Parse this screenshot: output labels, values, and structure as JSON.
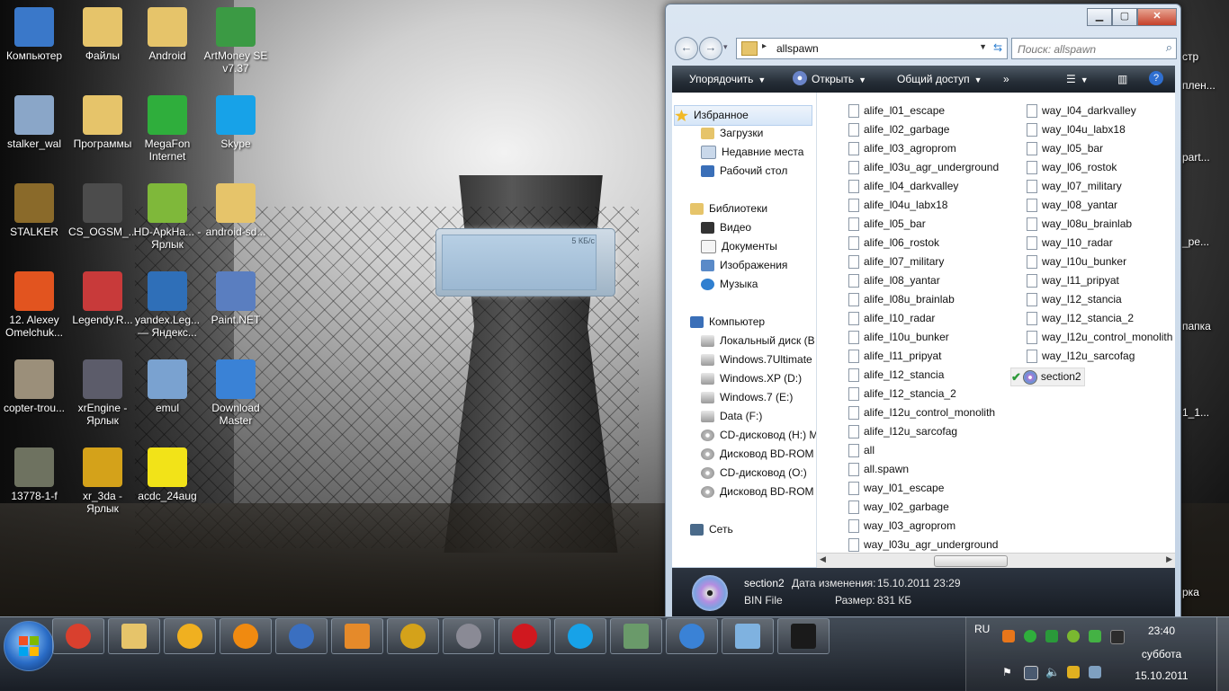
{
  "desktop": {
    "icons": [
      {
        "label": "Компьютер",
        "icon": "computer-icon",
        "color": "#3a78c9"
      },
      {
        "label": "Файлы",
        "icon": "folder-icon",
        "color": "#e6c46a"
      },
      {
        "label": "Android",
        "icon": "folder-icon",
        "color": "#e6c46a"
      },
      {
        "label": "ArtMoney SE v7.37",
        "icon": "money-icon",
        "color": "#3b9a44"
      },
      {
        "label": "stalker_wal",
        "icon": "image-icon",
        "color": "#8aa6c8"
      },
      {
        "label": "Программы",
        "icon": "folder-icon",
        "color": "#e6c46a"
      },
      {
        "label": "MegaFon Internet",
        "icon": "megafon-icon",
        "color": "#2fae3c"
      },
      {
        "label": "Skype",
        "icon": "skype-icon",
        "color": "#17a2e8"
      },
      {
        "label": "STALKER",
        "icon": "game-icon",
        "color": "#8a6a2a"
      },
      {
        "label": "CS_OGSM_...",
        "icon": "radiation-icon",
        "color": "#4c4c4c"
      },
      {
        "label": "HD-ApkHa... - Ярлык",
        "icon": "android-icon",
        "color": "#7fb83a"
      },
      {
        "label": "android-sd...",
        "icon": "folder-icon",
        "color": "#e6c46a"
      },
      {
        "label": "12. Alexey Omelchuk...",
        "icon": "mp3-icon",
        "color": "#e2541f"
      },
      {
        "label": "Legendy.R...",
        "icon": "archive-icon",
        "color": "#c83a3a"
      },
      {
        "label": "yandex.Leg... — Яндекс...",
        "icon": "flv-icon",
        "color": "#2f6fb8"
      },
      {
        "label": "Paint.NET",
        "icon": "paint-icon",
        "color": "#5a7ec0"
      },
      {
        "label": "copter-trou...",
        "icon": "image-icon",
        "color": "#9b8f7a"
      },
      {
        "label": "xrEngine - Ярлык",
        "icon": "radiation-icon",
        "color": "#5c5c6a"
      },
      {
        "label": "emul",
        "icon": "settings-icon",
        "color": "#7aa2d0"
      },
      {
        "label": "Download Master",
        "icon": "download-icon",
        "color": "#3a82d6"
      },
      {
        "label": "13778-1-f",
        "icon": "image-icon",
        "color": "#6e7260"
      },
      {
        "label": "xr_3da - Ярлык",
        "icon": "radiation-icon",
        "color": "#d4a21a"
      },
      {
        "label": "acdc_24aug",
        "icon": "smiley-icon",
        "color": "#f2e318"
      }
    ],
    "edge_labels": [
      "стр",
      "плен...",
      "part...",
      "_pe...",
      "папка",
      "1_1...",
      "рка"
    ]
  },
  "gadget": {
    "size_label": "5 КБ/с"
  },
  "explorer": {
    "path": "allspawn",
    "search_placeholder": "Поиск: allspawn",
    "toolbar": {
      "organize": "Упорядочить",
      "open": "Открыть",
      "share": "Общий доступ",
      "more": "»"
    },
    "nav": {
      "favorites": "Избранное",
      "downloads": "Загрузки",
      "recent": "Недавние места",
      "desktop": "Рабочий стол",
      "libraries": "Библиотеки",
      "video": "Видео",
      "documents": "Документы",
      "images": "Изображения",
      "music": "Музыка",
      "computer": "Компьютер",
      "drives": [
        "Локальный диск (B",
        "Windows.7Ultimate",
        "Windows.XP (D:)",
        "Windows.7 (E:)",
        "Data (F:)",
        "CD-дисковод (H:) M",
        "Дисковод BD-ROM",
        "CD-дисковод (O:)",
        "Дисковод BD-ROM"
      ],
      "network": "Сеть"
    },
    "files_col1": [
      "alife_l01_escape",
      "alife_l02_garbage",
      "alife_l03_agroprom",
      "alife_l03u_agr_underground",
      "alife_l04_darkvalley",
      "alife_l04u_labx18",
      "alife_l05_bar",
      "alife_l06_rostok",
      "alife_l07_military",
      "alife_l08_yantar",
      "alife_l08u_brainlab",
      "alife_l10_radar",
      "alife_l10u_bunker",
      "alife_l11_pripyat",
      "alife_l12_stancia",
      "alife_l12_stancia_2",
      "alife_l12u_control_monolith",
      "alife_l12u_sarcofag",
      "all",
      "all.spawn",
      "way_l01_escape",
      "way_l02_garbage",
      "way_l03_agroprom",
      "way_l03u_agr_underground"
    ],
    "files_col2": [
      "way_l04_darkvalley",
      "way_l04u_labx18",
      "way_l05_bar",
      "way_l06_rostok",
      "way_l07_military",
      "way_l08_yantar",
      "way_l08u_brainlab",
      "way_l10_radar",
      "way_l10u_bunker",
      "way_l11_pripyat",
      "way_l12_stancia",
      "way_l12_stancia_2",
      "way_l12u_control_monolith",
      "way_l12u_sarcofag"
    ],
    "selected_file": "section2",
    "details": {
      "name": "section2",
      "type": "BIN File",
      "modified_label": "Дата изменения:",
      "modified_value": "15.10.2011 23:29",
      "size_label": "Размер:",
      "size_value": "831 КБ"
    }
  },
  "taskbar": {
    "apps": [
      {
        "name": "chrome-icon",
        "color": "#d9402e"
      },
      {
        "name": "explorer-icon",
        "color": "#e6c46a"
      },
      {
        "name": "game-icon",
        "color": "#f0b020"
      },
      {
        "name": "aimp-icon",
        "color": "#f08a10"
      },
      {
        "name": "kmplayer-icon",
        "color": "#3a6fc0"
      },
      {
        "name": "media-player-icon",
        "color": "#e58a2a"
      },
      {
        "name": "radiation-icon",
        "color": "#d4a21a"
      },
      {
        "name": "radiation-icon",
        "color": "#8a8a95"
      },
      {
        "name": "opera-icon",
        "color": "#d0181f"
      },
      {
        "name": "skype-icon",
        "color": "#17a2e8"
      },
      {
        "name": "monitor-icon",
        "color": "#6a9a6a"
      },
      {
        "name": "download-icon",
        "color": "#3a82d6"
      },
      {
        "name": "notepad-icon",
        "color": "#7fb2e0"
      },
      {
        "name": "cmd-icon",
        "color": "#1a1a1a"
      }
    ],
    "tray": {
      "lang": "RU",
      "time": "23:40",
      "day": "суббота",
      "date": "15.10.2011"
    }
  }
}
